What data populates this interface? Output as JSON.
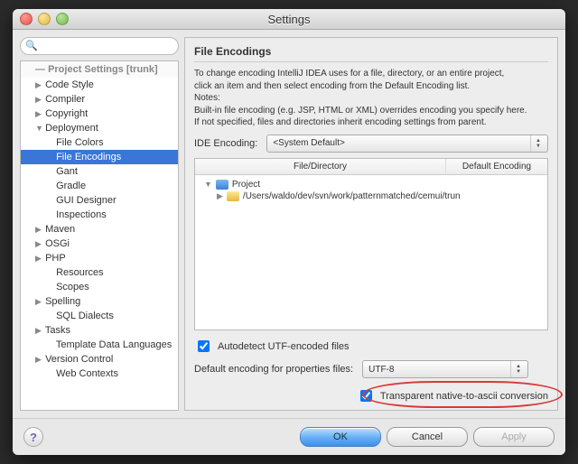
{
  "window": {
    "title": "Settings"
  },
  "search": {
    "placeholder": ""
  },
  "sidebar": {
    "header": "Project Settings [trunk]",
    "items": [
      {
        "label": "Code Style",
        "expandable": true
      },
      {
        "label": "Compiler",
        "expandable": true
      },
      {
        "label": "Copyright",
        "expandable": true
      },
      {
        "label": "Deployment",
        "expandable": true,
        "expanded": true
      },
      {
        "label": "File Colors",
        "child": true
      },
      {
        "label": "File Encodings",
        "child": true,
        "selected": true
      },
      {
        "label": "Gant",
        "child": true
      },
      {
        "label": "Gradle",
        "child": true
      },
      {
        "label": "GUI Designer",
        "child": true
      },
      {
        "label": "Inspections",
        "child": true
      },
      {
        "label": "Maven",
        "expandable": true
      },
      {
        "label": "OSGi",
        "expandable": true
      },
      {
        "label": "PHP",
        "expandable": true
      },
      {
        "label": "Resources",
        "child": true
      },
      {
        "label": "Scopes",
        "child": true
      },
      {
        "label": "Spelling",
        "expandable": true
      },
      {
        "label": "SQL Dialects",
        "child": true
      },
      {
        "label": "Tasks",
        "expandable": true
      },
      {
        "label": "Template Data Languages",
        "child": true
      },
      {
        "label": "Version Control",
        "expandable": true
      },
      {
        "label": "Web Contexts",
        "child": true
      }
    ]
  },
  "panel": {
    "title": "File Encodings",
    "desc_line1": "To change encoding IntelliJ IDEA uses for a file, directory, or an entire project,",
    "desc_line2": "click an item and then select encoding from the Default Encoding list.",
    "notes_label": "Notes:",
    "notes_line1": "Built-in file encoding (e.g. JSP, HTML or XML) overrides encoding you specify here.",
    "notes_line2": "If not specified, files and directories inherit encoding settings from parent.",
    "ide_encoding_label": "IDE Encoding:",
    "ide_encoding_value": "<System Default>",
    "table": {
      "col_file": "File/Directory",
      "col_enc": "Default Encoding",
      "root": "Project",
      "path": "/Users/waldo/dev/svn/work/patternmatched/cemui/trun"
    },
    "autodetect_label": "Autodetect UTF-encoded files",
    "autodetect_checked": true,
    "props_label": "Default encoding for properties files:",
    "props_value": "UTF-8",
    "transparent_label": "Transparent native-to-ascii conversion",
    "transparent_checked": true
  },
  "footer": {
    "ok": "OK",
    "cancel": "Cancel",
    "apply": "Apply"
  }
}
